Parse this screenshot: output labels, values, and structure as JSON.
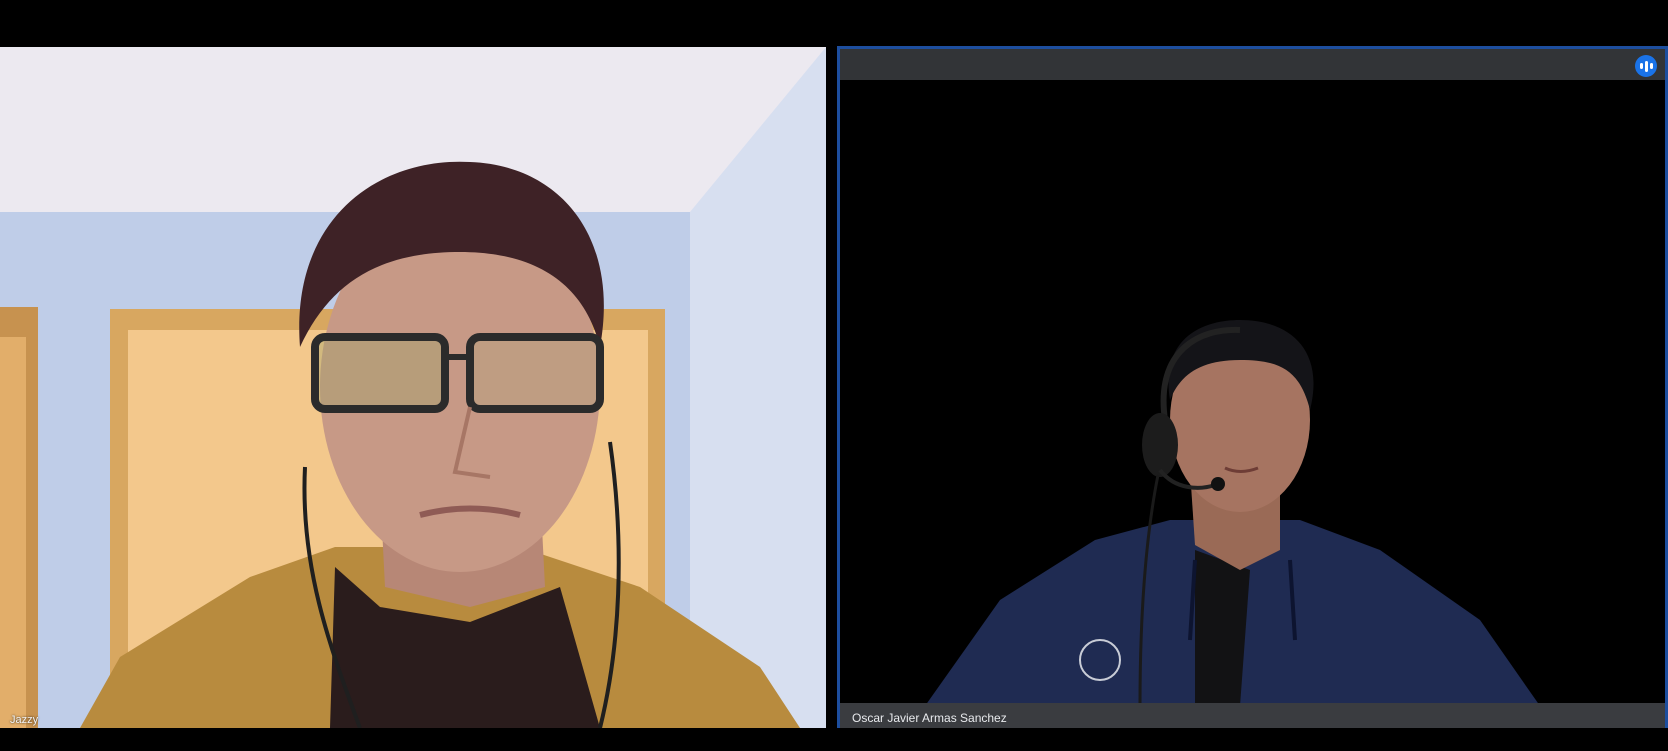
{
  "call": {
    "participants": [
      {
        "name": "Jazzy",
        "active_speaker": false
      },
      {
        "name": "Oscar Javier Armas Sanchez",
        "active_speaker": true
      }
    ]
  },
  "icons": {
    "speaking_indicator": "audio-level-icon"
  },
  "colors": {
    "background": "#000000",
    "active_speaker_border": "#1d4e9e",
    "speaking_indicator": "#1a73e8",
    "tile_header": "#323437",
    "name_bar": "#3a3c40"
  }
}
